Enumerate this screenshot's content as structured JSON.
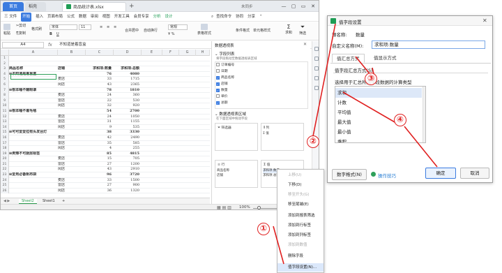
{
  "colors": {
    "accent": "#3a7be0",
    "excel_green": "#1f9d55",
    "annotation_red": "#e02020",
    "selection_green": "#2fa15a"
  },
  "titlebar": {
    "tab_home": "首页",
    "tab_wps": "稻壳",
    "doc_tab": "商品统计表.xlsx",
    "plus": "+",
    "unsynced": "未同步",
    "window_buttons": [
      "—",
      "▢",
      "▭",
      "✕"
    ]
  },
  "menubar": {
    "items": [
      "三 文件",
      "开始",
      "插入",
      "页面布局",
      "公式",
      "数据",
      "审阅",
      "视图",
      "开发工具",
      "会员专享",
      "分析",
      "设计"
    ],
    "active": "开始",
    "search": "查找命令",
    "collab": "协同",
    "share": "分享",
    "collapse": "⌃"
  },
  "ribbon": {
    "paste": "粘贴",
    "cut": "剪切",
    "copy": "复制",
    "format_painter": "格式刷",
    "font": "宋体",
    "size": "11",
    "bold": "B",
    "underline": "U",
    "merge": "合并居中",
    "wrap": "自动换行",
    "number_format": "常规",
    "currency": "¥ %",
    "table_style": "表格样式",
    "cond_format": "条件格式",
    "cell_style": "单元格样式",
    "sum": "求和",
    "filter": "筛选"
  },
  "formula": {
    "cell": "A4",
    "fx": "fx",
    "text": "不知道是着盲盒"
  },
  "sheet": {
    "columns": [
      "A",
      "B",
      "C",
      "D",
      "E",
      "F",
      "G",
      "H"
    ],
    "rows": [
      {
        "c": [
          "",
          "",
          "",
          ""
        ],
        "b": false
      },
      {
        "c": [
          "",
          "",
          "",
          ""
        ],
        "b": false
      },
      {
        "c": [
          "商品名称",
          "店铺",
          "求和项:数量",
          "求和项:总额"
        ],
        "b": true
      },
      {
        "c": [
          "⊟不知道是着盲盒",
          "",
          "76",
          "4080"
        ],
        "b": true
      },
      {
        "c": [
          "",
          "麦店",
          "33",
          "1715"
        ],
        "b": false
      },
      {
        "c": [
          "",
          "闵店",
          "43",
          "2365"
        ],
        "b": false
      },
      {
        "c": [
          "⊟根本睡不醒眼罩",
          "",
          "78",
          "1810"
        ],
        "b": true
      },
      {
        "c": [
          "",
          "麦店",
          "24",
          "360"
        ],
        "b": false
      },
      {
        "c": [
          "",
          "雷店",
          "22",
          "530"
        ],
        "b": false
      },
      {
        "c": [
          "",
          "闵店",
          "32",
          "920"
        ],
        "b": false
      },
      {
        "c": [
          "⊟根本睡不着毛毯",
          "",
          "54",
          "2700"
        ],
        "b": true
      },
      {
        "c": [
          "",
          "麦店",
          "24",
          "1050"
        ],
        "b": false
      },
      {
        "c": [
          "",
          "雷店",
          "31",
          "1155"
        ],
        "b": false
      },
      {
        "c": [
          "",
          "闵店",
          "9",
          "535"
        ],
        "b": false
      },
      {
        "c": [
          "⊟可可爱爱拉有头发台灯",
          "",
          "38",
          "3330"
        ],
        "b": true
      },
      {
        "c": [
          "",
          "麦店",
          "42",
          "2490"
        ],
        "b": false
      },
      {
        "c": [
          "",
          "雷店",
          "35",
          "585"
        ],
        "b": false
      },
      {
        "c": [
          "",
          "闵店",
          "4",
          "255"
        ],
        "b": false
      },
      {
        "c": [
          "⊟卖辣不可厨房标签",
          "",
          "85",
          "4815"
        ],
        "b": true
      },
      {
        "c": [
          "",
          "麦店",
          "15",
          "705"
        ],
        "b": false
      },
      {
        "c": [
          "",
          "雷店",
          "27",
          "1200"
        ],
        "b": false
      },
      {
        "c": [
          "",
          "闵店",
          "43",
          "2910"
        ],
        "b": false
      },
      {
        "c": [
          "⊟爱男必备帆布袋",
          "",
          "96",
          "3720"
        ],
        "b": true
      },
      {
        "c": [
          "",
          "麦店",
          "33",
          "1500"
        ],
        "b": false
      },
      {
        "c": [
          "",
          "雷店",
          "27",
          "900"
        ],
        "b": false
      },
      {
        "c": [
          "",
          "闵店",
          "36",
          "1320"
        ],
        "b": false
      }
    ],
    "tabs": [
      "Sheet2",
      "Sheet1",
      "+"
    ]
  },
  "statusbar": {
    "zoom": "100%"
  },
  "pane": {
    "title": "数据透视表",
    "close": "✕",
    "fields_title": "字段列表",
    "fields_hint": "将字段拖动至数据透视表区域",
    "fields": [
      {
        "name": "订单编号",
        "checked": false
      },
      {
        "name": "日期",
        "checked": false
      },
      {
        "name": "商品名称",
        "checked": true
      },
      {
        "name": "店铺",
        "checked": true
      },
      {
        "name": "数量",
        "checked": true
      },
      {
        "name": "单价",
        "checked": false
      },
      {
        "name": "总额",
        "checked": true
      }
    ],
    "areas_title": "数据透视表区域",
    "areas_hint": "在下面区域中拖动字段",
    "filter_label": "筛选器",
    "columns_label": "列",
    "columns_item": "Σ 值",
    "rows_label": "行",
    "rows_items": [
      "商品名称",
      "店铺"
    ],
    "values_label": "值",
    "values_items": [
      "求和项:数量",
      "求和项:总额"
    ]
  },
  "context_menu": {
    "items": [
      {
        "label": "上移(U)",
        "disabled": true
      },
      {
        "label": "下移(D)",
        "disabled": false
      },
      {
        "label": "移至开头(G)",
        "disabled": true
      },
      {
        "label": "移至尾端(E)",
        "disabled": false
      },
      {
        "label": "添加到报表筛选",
        "disabled": false
      },
      {
        "label": "添加到行标签",
        "disabled": false
      },
      {
        "label": "添加到列标签",
        "disabled": false
      },
      {
        "label": "添加到数值",
        "disabled": true
      },
      {
        "label": "删除字段",
        "disabled": false
      },
      {
        "label": "值字段设置(N)...",
        "disabled": false
      }
    ],
    "highlighted": "值字段设置(N)..."
  },
  "dialog": {
    "title": "值字段设置",
    "close": "✕",
    "source_label": "源名称:",
    "source_value": "数量",
    "custom_label": "自定义名称(M):",
    "custom_value": "求和项:数量",
    "tab_summary": "值汇总方式",
    "tab_show": "值显示方式",
    "group_label": "值字段汇总方式(S)",
    "group_hint": "选择用于汇总所选字段数据的计算类型",
    "list": [
      "求和",
      "计数",
      "平均值",
      "最大值",
      "最小值",
      "乘积"
    ],
    "selected": "求和",
    "number_format_btn": "数字格式(N)",
    "tips_link": "操作技巧",
    "ok_btn": "确定",
    "cancel_btn": "取消"
  },
  "annotations": {
    "step1": "①",
    "step2": "②",
    "step3": "③",
    "step4": "④"
  }
}
